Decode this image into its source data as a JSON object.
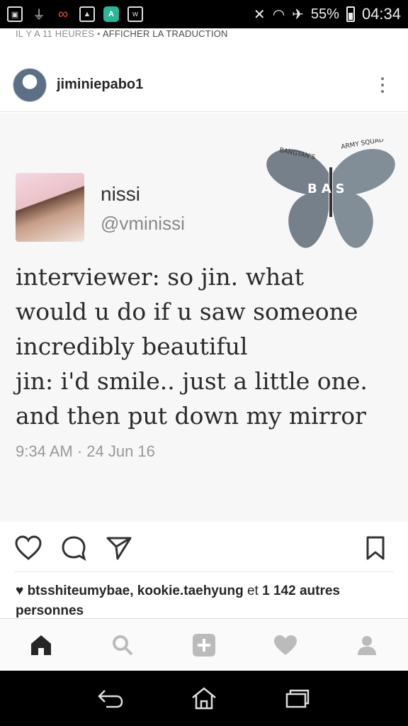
{
  "status_bar": {
    "battery": "55%",
    "time": "04:34",
    "icons": [
      "sim-icon",
      "usb-icon",
      "color-app-icon",
      "image-icon",
      "aptoide-icon",
      "w-icon",
      "no-signal-icon",
      "wifi-icon",
      "airplane-icon",
      "battery-icon"
    ]
  },
  "post": {
    "time_ago": "IL Y A 11 HEURES",
    "separator": "•",
    "translate": "AFFICHER LA TRADUCTION",
    "username": "jiminiepabo1"
  },
  "tweet": {
    "name": "nissi",
    "handle": "@vminissi",
    "lines": [
      "interviewer: so jin. what",
      "would u do if u saw someone",
      "incredibly beautiful",
      "jin: i'd smile.. just a little one.",
      "and then put down my mirror"
    ],
    "date": "9:34 AM · 24 Jun 16",
    "watermark": {
      "arc_left": "BANGTAN'S",
      "arc_right": "ARMY SQUAD",
      "center": "BAS"
    }
  },
  "likes": {
    "users": "btsshiteumybae, kookie.taehyung",
    "connector": "et",
    "count": "1 142 autres",
    "tail": "personnes"
  },
  "colors": {
    "text": "#262626",
    "muted": "#8e8e8e",
    "nav_bg": "#fafafa",
    "status_bg": "#000000"
  }
}
